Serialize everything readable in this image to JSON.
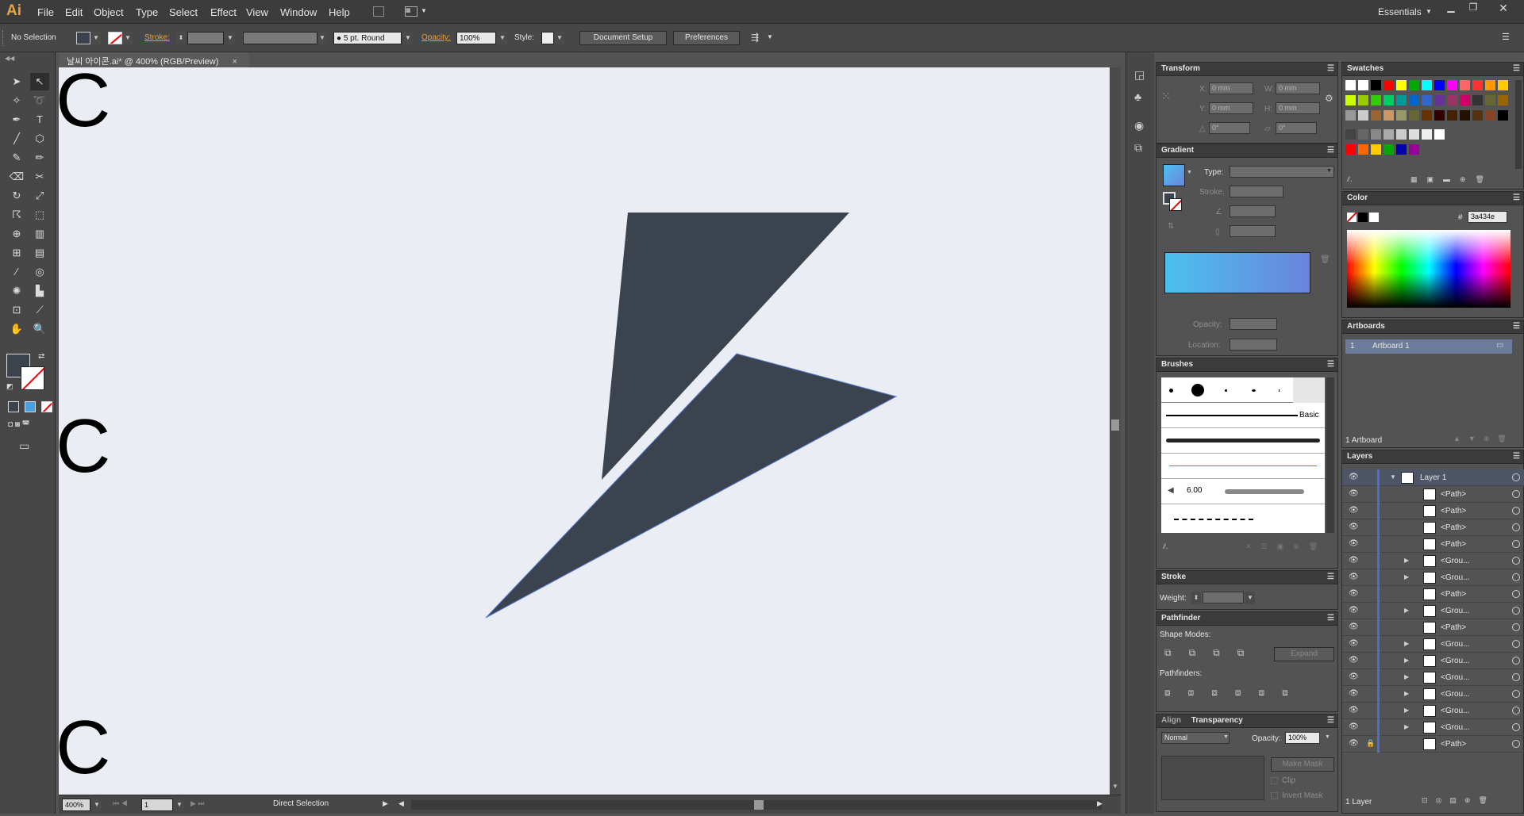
{
  "app": {
    "logo": "Ai"
  },
  "menu": [
    "File",
    "Edit",
    "Object",
    "Type",
    "Select",
    "Effect",
    "View",
    "Window",
    "Help"
  ],
  "workspace": "Essentials",
  "control": {
    "selection": "No Selection",
    "stroke_label": "Stroke:",
    "brush": "5 pt. Round",
    "opacity_label": "Opacity:",
    "opacity": "100%",
    "style_label": "Style:",
    "doc_setup": "Document Setup",
    "preferences": "Preferences"
  },
  "document": {
    "tab": "날씨 아이콘.ai* @ 400% (RGB/Preview)",
    "close": "×",
    "canvas_glyph": "C"
  },
  "status": {
    "zoom": "400%",
    "page": "1",
    "tool": "Direct Selection"
  },
  "transform": {
    "title": "Transform",
    "x_label": "X:",
    "x": "0 mm",
    "y_label": "Y:",
    "y": "0 mm",
    "w_label": "W:",
    "w": "0 mm",
    "h_label": "H:",
    "h": "0 mm",
    "angle": "0°",
    "shear": "0°"
  },
  "gradient": {
    "title": "Gradient",
    "type_label": "Type:",
    "stroke_label": "Stroke:",
    "opacity_label": "Opacity:",
    "location_label": "Location:",
    "ramp_start": "#4ac1ef",
    "ramp_end": "#6a84dc"
  },
  "brushes": {
    "title": "Brushes",
    "basic": "Basic",
    "size": "6.00"
  },
  "stroke": {
    "title": "Stroke",
    "weight_label": "Weight:"
  },
  "pathfinder": {
    "title": "Pathfinder",
    "shape_modes": "Shape Modes:",
    "pathfinders": "Pathfinders:",
    "expand": "Expand"
  },
  "transparency": {
    "tab_align": "Align",
    "tab_transparency": "Transparency",
    "mode": "Normal",
    "opacity_label": "Opacity:",
    "opacity": "100%",
    "make_mask": "Make Mask",
    "clip": "Clip",
    "invert": "Invert Mask"
  },
  "swatches": {
    "title": "Swatches"
  },
  "color": {
    "title": "Color",
    "hex_prefix": "#",
    "hex": "3a434e"
  },
  "artboards": {
    "title": "Artboards",
    "num": "1",
    "name": "Artboard 1",
    "count": "1 Artboard"
  },
  "layers": {
    "title": "Layers",
    "layer_name": "Layer 1",
    "items": [
      "<Path>",
      "<Path>",
      "<Path>",
      "<Path>",
      "<Grou...",
      "<Grou...",
      "<Path>",
      "<Grou...",
      "<Path>",
      "<Grou...",
      "<Grou...",
      "<Grou...",
      "<Grou...",
      "<Grou...",
      "<Grou...",
      "<Path>"
    ],
    "count": "1 Layer"
  },
  "colors": {
    "fill": "#3a434e",
    "canvas": "#eaedf3",
    "accent": "#e8a33b"
  }
}
